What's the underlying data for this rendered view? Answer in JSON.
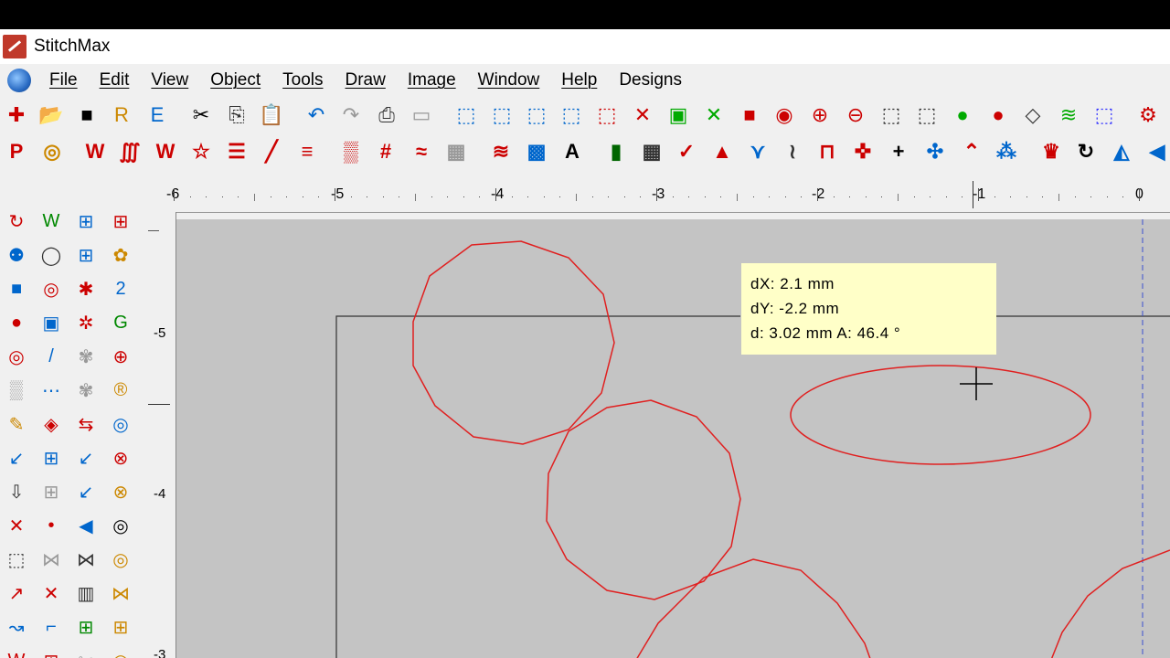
{
  "app": {
    "title": "StitchMax"
  },
  "menu": [
    "File",
    "Edit",
    "View",
    "Object",
    "Tools",
    "Draw",
    "Image",
    "Window",
    "Help",
    "Designs"
  ],
  "ruler": {
    "horizontal": [
      "-6",
      "-5",
      "-4",
      "-3",
      "-2",
      "-1",
      "0"
    ],
    "vertical": [
      "-5",
      "-4",
      "-3"
    ]
  },
  "tooltip": {
    "dx": "dX: 2.1 mm",
    "dy": "dY: -2.2 mm",
    "d": "d: 3.02 mm A: 46.4 °"
  },
  "colors": {
    "accent": "#e02020",
    "canvas": "#c4c4c4",
    "tooltip_bg": "#ffffc8"
  },
  "toolbar1_icons": [
    "new-icon",
    "open-icon",
    "save-icon",
    "r-icon",
    "e-icon",
    "cut-icon",
    "copy-icon",
    "paste-icon",
    "undo-icon",
    "redo-icon",
    "print-icon",
    "scanner-icon",
    "select-icon",
    "select-node-icon",
    "select-area-icon",
    "select-add-icon",
    "select-remove-icon",
    "deselect-icon",
    "group-icon",
    "ungroup-icon",
    "color-icon",
    "zoom-icon",
    "zoom-in-icon",
    "zoom-out-icon",
    "zoom-window-icon",
    "zoom-fit-icon",
    "fill-icon",
    "shape-icon",
    "outline-icon",
    "stitch-icon",
    "lasso-icon",
    "settings-icon"
  ],
  "toolbar2_icons": [
    "pm-icon",
    "target-icon",
    "zigzag-icon",
    "column-icon",
    "satin-icon",
    "star-icon",
    "lines-icon",
    "line-icon",
    "run-icon",
    "cross-icon",
    "grid-icon",
    "arc-icon",
    "fill-pattern-icon",
    "wave-icon",
    "maze-icon",
    "text-icon",
    "bar-icon",
    "hatch-icon",
    "tack-icon",
    "triangle-icon",
    "fan-icon",
    "mesh-icon",
    "lock-icon",
    "stamp-icon",
    "point-icon",
    "move-icon",
    "arch-icon",
    "dots-icon",
    "crown-icon",
    "rotate-icon",
    "mirror-icon",
    "arrow-icon"
  ],
  "left_icons": [
    "tool-a",
    "tool-b",
    "tool-c",
    "tool-d"
  ]
}
